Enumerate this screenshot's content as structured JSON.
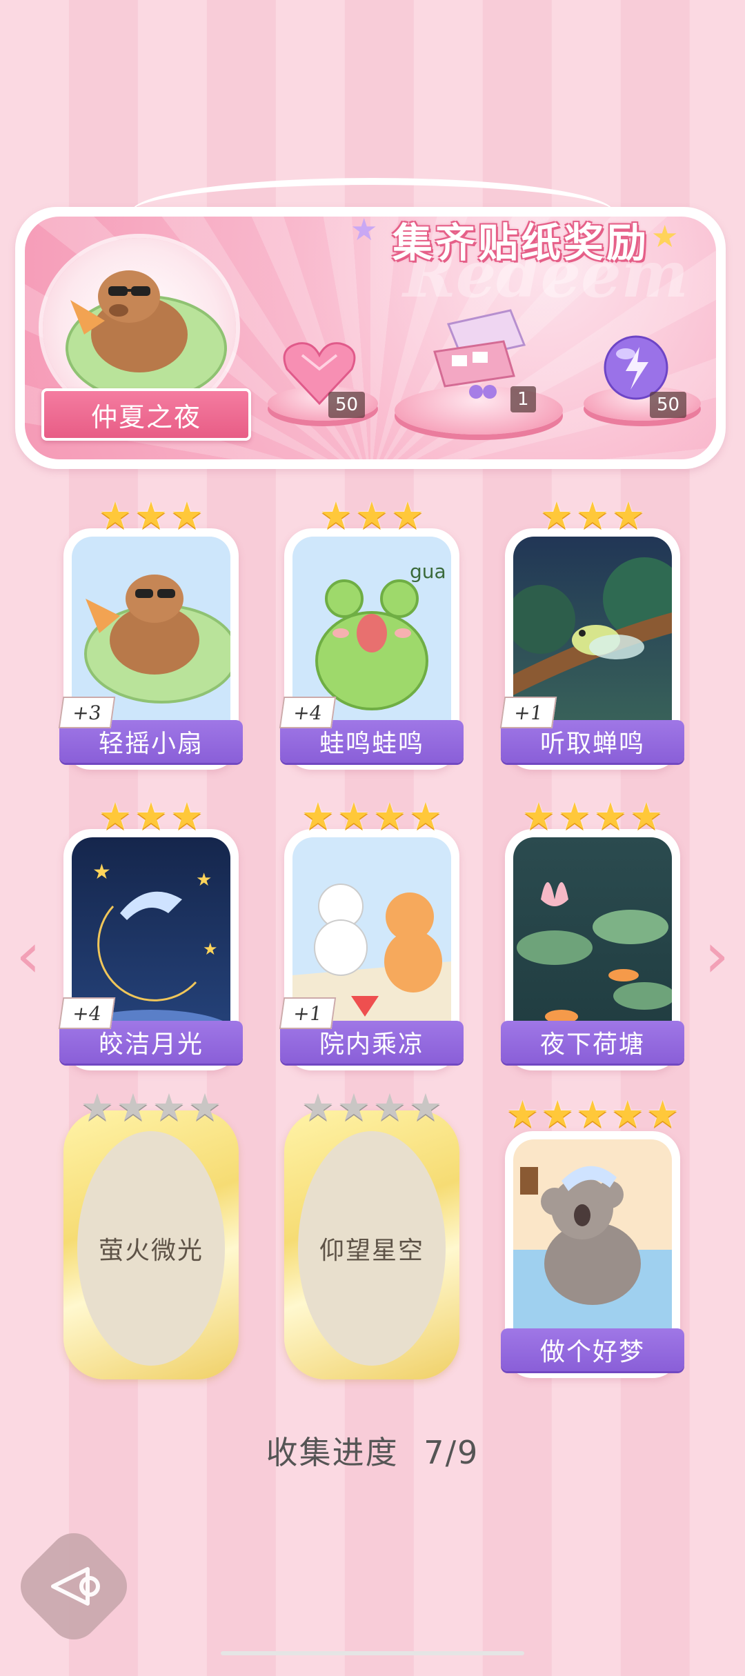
{
  "banner": {
    "title": "集齐贴纸奖励",
    "watermark": "Redeem",
    "featured_label": "仲夏之夜",
    "rewards": [
      {
        "icon": "pink-heart-gem-icon",
        "count": "50"
      },
      {
        "icon": "gift-box-icon",
        "count": "1"
      },
      {
        "icon": "purple-energy-orb-icon",
        "count": "50"
      }
    ]
  },
  "cards": [
    {
      "label": "轻摇小扇",
      "stars": 3,
      "stars_total": 3,
      "bonus": "+3",
      "image": "capybara-fan"
    },
    {
      "label": "蛙鸣蛙鸣",
      "stars": 3,
      "stars_total": 3,
      "bonus": "+4",
      "image": "frog-gua",
      "image_text": "gua"
    },
    {
      "label": "听取蝉鸣",
      "stars": 3,
      "stars_total": 3,
      "bonus": "+1",
      "image": "cicada-branch"
    },
    {
      "label": "皎洁月光",
      "stars": 3,
      "stars_total": 3,
      "bonus": "+4",
      "image": "sleepy-moon"
    },
    {
      "label": "院内乘凉",
      "stars": 4,
      "stars_total": 4,
      "bonus": "+1",
      "image": "cats-watermelon"
    },
    {
      "label": "夜下荷塘",
      "stars": 4,
      "stars_total": 4,
      "bonus": "",
      "image": "lotus-pond-koi"
    },
    {
      "label": "萤火微光",
      "stars": 0,
      "stars_total": 4,
      "bonus": "",
      "locked": true
    },
    {
      "label": "仰望星空",
      "stars": 0,
      "stars_total": 4,
      "bonus": "",
      "locked": true
    },
    {
      "label": "做个好梦",
      "stars": 5,
      "stars_total": 5,
      "bonus": "",
      "image": "sleeping-koala"
    }
  ],
  "progress": {
    "label": "收集进度",
    "value": "7/9"
  },
  "colors": {
    "accent_purple": "#8a5fd8",
    "banner_pink": "#f59ab6",
    "star_gold": "#ffc83a"
  }
}
